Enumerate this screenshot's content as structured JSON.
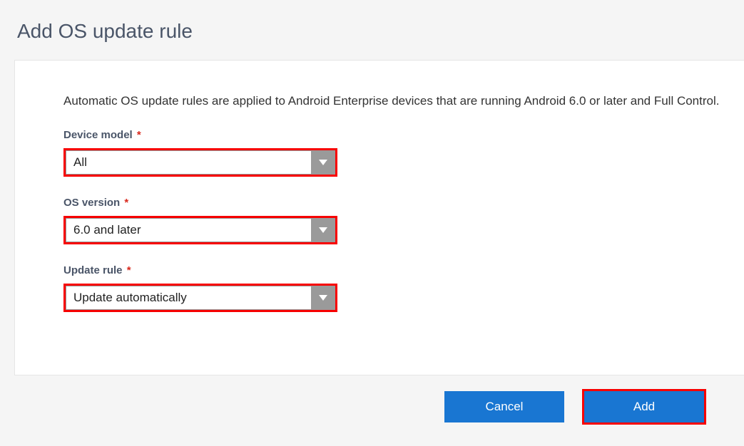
{
  "title": "Add OS update rule",
  "description": "Automatic OS update rules are applied to Android Enterprise devices that are running Android 6.0 or later and Full Control.",
  "fields": {
    "device_model": {
      "label": "Device model",
      "required_marker": "*",
      "value": "All"
    },
    "os_version": {
      "label": "OS version",
      "required_marker": "*",
      "value": "6.0 and later"
    },
    "update_rule": {
      "label": "Update rule",
      "required_marker": "*",
      "value": "Update automatically"
    }
  },
  "buttons": {
    "cancel": "Cancel",
    "add": "Add"
  }
}
